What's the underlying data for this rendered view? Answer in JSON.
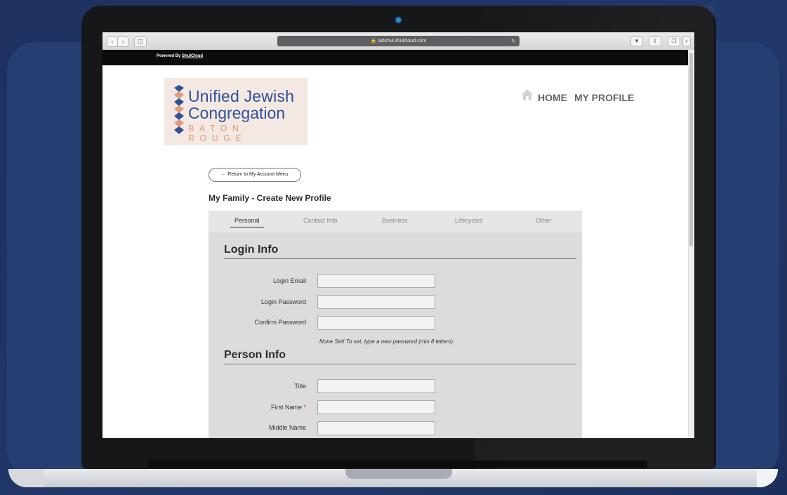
{
  "browser": {
    "url": "labshul.shulcloud.com",
    "back_icon": "chevron-left-icon",
    "forward_icon": "chevron-right-icon"
  },
  "powered_bar": {
    "prefix": "Powered By",
    "link": "ShulCloud"
  },
  "logo": {
    "line1": "Unified Jewish",
    "line2": "Congregation",
    "line3": "BATON ROUGE"
  },
  "nav": {
    "home": "HOME",
    "my_profile": "MY PROFILE"
  },
  "return_button": "← Return to My Account Menu",
  "page_heading": "My Family - Create New Profile",
  "tabs": [
    {
      "label": "Personal",
      "active": true
    },
    {
      "label": "Contact Info",
      "active": false
    },
    {
      "label": "Business",
      "active": false
    },
    {
      "label": "Lifecycles",
      "active": false
    },
    {
      "label": "Other",
      "active": false
    }
  ],
  "login_info": {
    "title": "Login Info",
    "fields": [
      {
        "label": "Login Email",
        "value": ""
      },
      {
        "label": "Login Password",
        "value": ""
      },
      {
        "label": "Confirm Password",
        "value": ""
      }
    ],
    "hint": "None Set! To set, type a new password (min 8 letters)."
  },
  "person_info": {
    "title": "Person Info",
    "fields": [
      {
        "label": "Title",
        "required": false,
        "value": ""
      },
      {
        "label": "First Name",
        "required": true,
        "required_mark": "*",
        "value": ""
      },
      {
        "label": "Middle Name",
        "required": false,
        "value": ""
      }
    ]
  },
  "colors": {
    "logo_blue": "#2f4f98",
    "logo_coral": "#e19a7c",
    "required_red": "#d0342c",
    "background_navy": "#1f3565"
  }
}
